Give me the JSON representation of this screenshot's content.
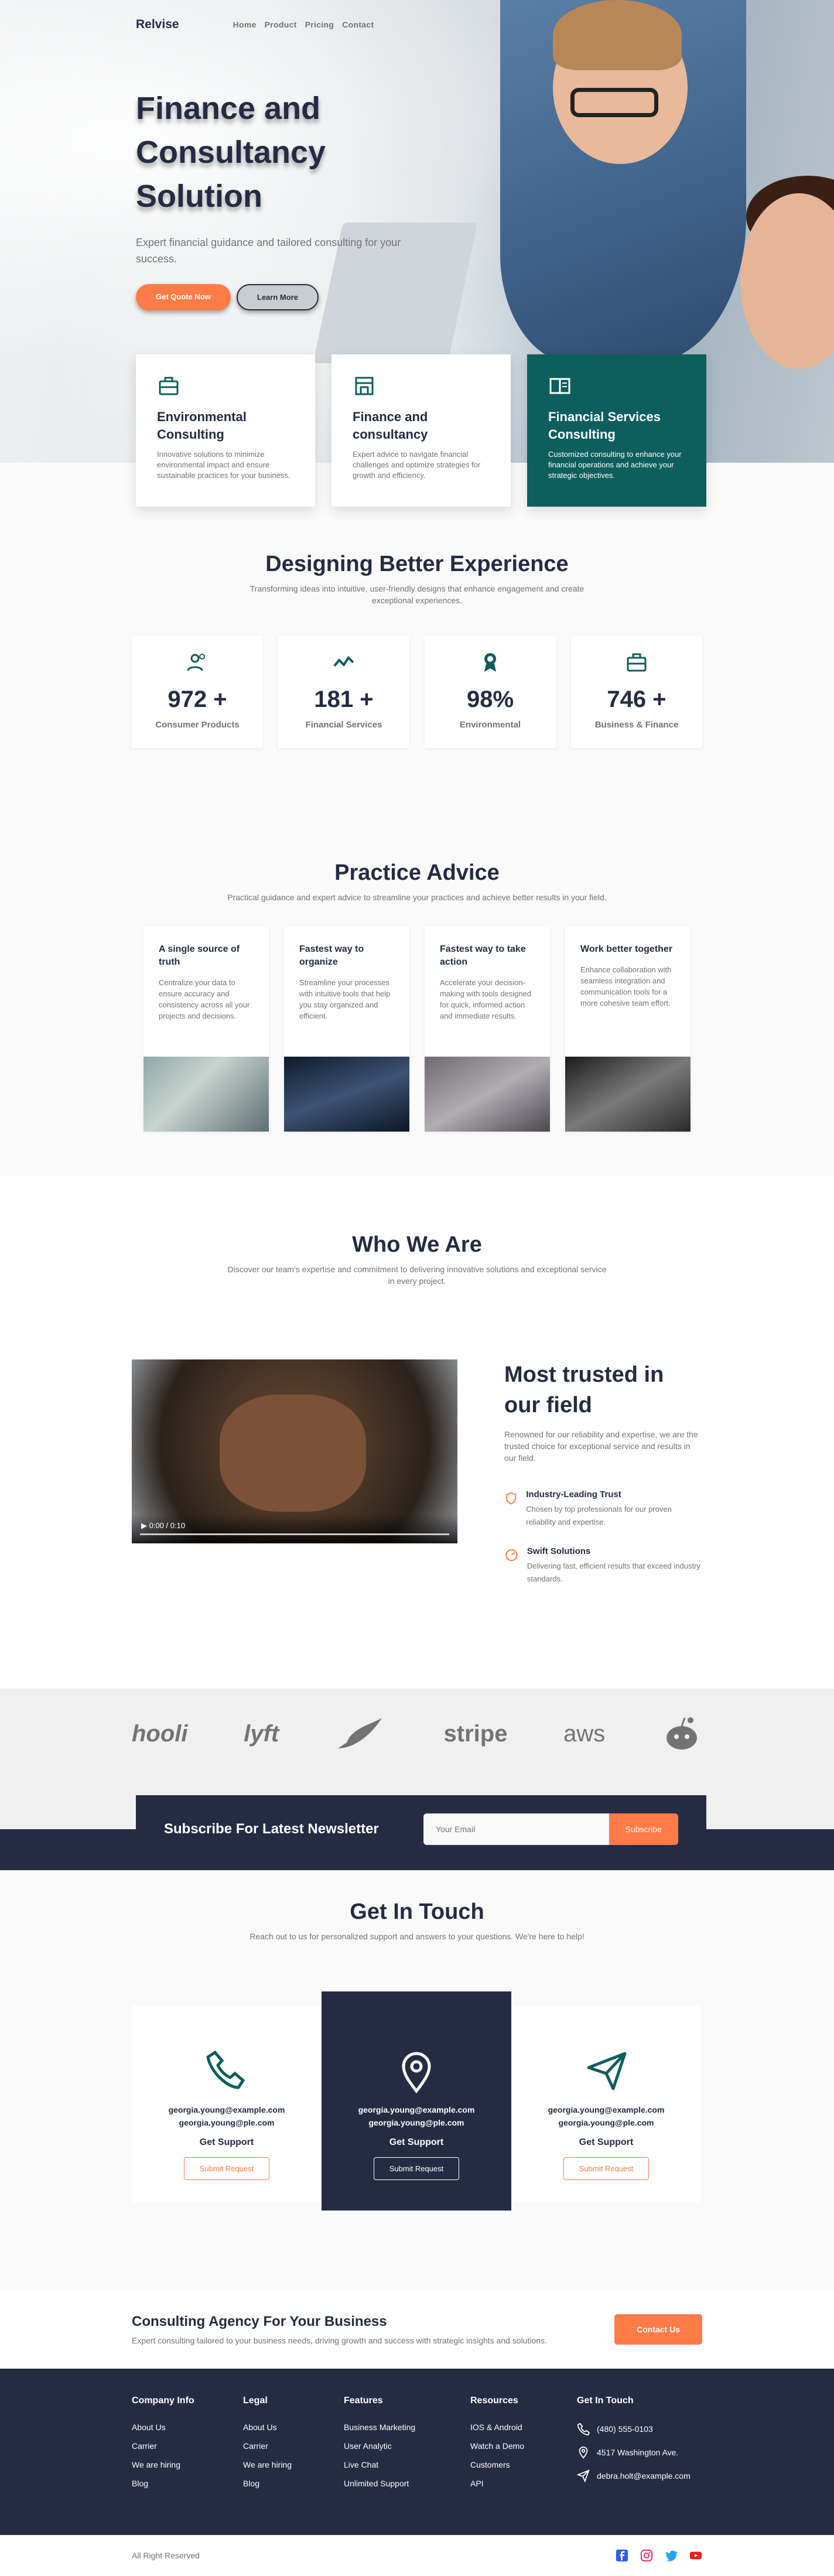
{
  "nav": {
    "logo": "Relvise",
    "items": [
      "Home",
      "Product",
      "Pricing",
      "Contact"
    ]
  },
  "hero": {
    "title": "Finance and Consultancy Solution",
    "subtitle": "Expert financial guidance and tailored consulting for your success.",
    "btn_primary": "Get Quote Now",
    "btn_secondary": "Learn More"
  },
  "services": [
    {
      "title": "Environmental Consulting",
      "desc": "Innovative solutions to minimize environmental impact and ensure sustainable practices for your business."
    },
    {
      "title": "Finance and consultancy",
      "desc": "Expert advice to navigate financial challenges and optimize strategies for growth and efficiency."
    },
    {
      "title": "Financial Services Consulting",
      "desc": "Customized consulting to enhance your financial operations and achieve your strategic objectives."
    }
  ],
  "experience": {
    "title": "Designing Better Experience",
    "subtitle": "Transforming ideas into intuitive, user-friendly designs that enhance engagement and create exceptional experiences.",
    "stats": [
      {
        "n": "972 +",
        "l": "Consumer Products"
      },
      {
        "n": "181 +",
        "l": "Financial Services"
      },
      {
        "n": "98%",
        "l": "Environmental"
      },
      {
        "n": "746 +",
        "l": "Business & Finance"
      }
    ]
  },
  "practice": {
    "title": "Practice Advice",
    "subtitle": "Practical guidance and expert advice to streamline your practices and achieve better results in your field.",
    "cards": [
      {
        "title": "A single source of truth",
        "desc": "Centralize your data to ensure accuracy and consistency across all your projects and decisions."
      },
      {
        "title": "Fastest way to organize",
        "desc": "Streamline your processes with intuitive tools that help you stay organized and efficient."
      },
      {
        "title": "Fastest way to take action",
        "desc": "Accelerate your decision-making with tools designed for quick, informed action and immediate results."
      },
      {
        "title": "Work better together",
        "desc": "Enhance collaboration with seamless integration and communication tools for a more cohesive team effort."
      }
    ]
  },
  "who": {
    "title": "Who We Are",
    "subtitle": "Discover our team's expertise and commitment to delivering innovative solutions and exceptional service in every project.",
    "video_time": "0:00 / 0:10",
    "heading": "Most trusted in our field",
    "desc": "Renowned for our reliability and expertise, we are the trusted choice for exceptional service and results in our field.",
    "features": [
      {
        "title": "Industry-Leading Trust",
        "desc": "Chosen by top professionals for our proven reliability and expertise."
      },
      {
        "title": "Swift Solutions",
        "desc": "Delivering fast, efficient results that exceed industry standards."
      }
    ]
  },
  "brands": [
    "hooli",
    "lyft",
    "",
    "stripe",
    "aws",
    ""
  ],
  "newsletter": {
    "title": "Subscribe For Latest Newsletter",
    "placeholder": "Your Email",
    "button": "Subscribe"
  },
  "contact": {
    "title": "Get In Touch",
    "subtitle": "Reach out to us for personalized support and answers to your questions. We're here to help!",
    "cards": [
      {
        "email1": "georgia.young@example.com",
        "email2": "georgia.young@ple.com",
        "label": "Get Support",
        "button": "Submit Request"
      },
      {
        "email1": "georgia.young@example.com",
        "email2": "georgia.young@ple.com",
        "label": "Get Support",
        "button": "Submit Request"
      },
      {
        "email1": "georgia.young@example.com",
        "email2": "georgia.young@ple.com",
        "label": "Get Support",
        "button": "Submit Request"
      }
    ]
  },
  "cta": {
    "title": "Consulting Agency For Your Business",
    "desc": "Expert consulting tailored to your business needs, driving growth and success with strategic insights and solutions.",
    "button": "Contact Us"
  },
  "footer": {
    "cols": [
      {
        "title": "Company Info",
        "links": [
          "About Us",
          "Carrier",
          "We are hiring",
          "Blog"
        ]
      },
      {
        "title": "Legal",
        "links": [
          "About Us",
          "Carrier",
          "We are hiring",
          "Blog"
        ]
      },
      {
        "title": "Features",
        "links": [
          "Business Marketing",
          "User Analytic",
          "Live Chat",
          "Unlimited Support"
        ]
      },
      {
        "title": "Resources",
        "links": [
          "IOS & Android",
          "Watch a Demo",
          "Customers",
          "API"
        ]
      }
    ],
    "contact": {
      "title": "Get In Touch",
      "phone": "(480) 555-0103",
      "address": "4517 Washington Ave.",
      "email": "debra.holt@example.com"
    },
    "copyright": "All Right Reserved"
  },
  "colors": {
    "accent": "#ff7b47",
    "dark": "#252b42",
    "teal": "#0f5e5e",
    "muted": "#737373"
  }
}
